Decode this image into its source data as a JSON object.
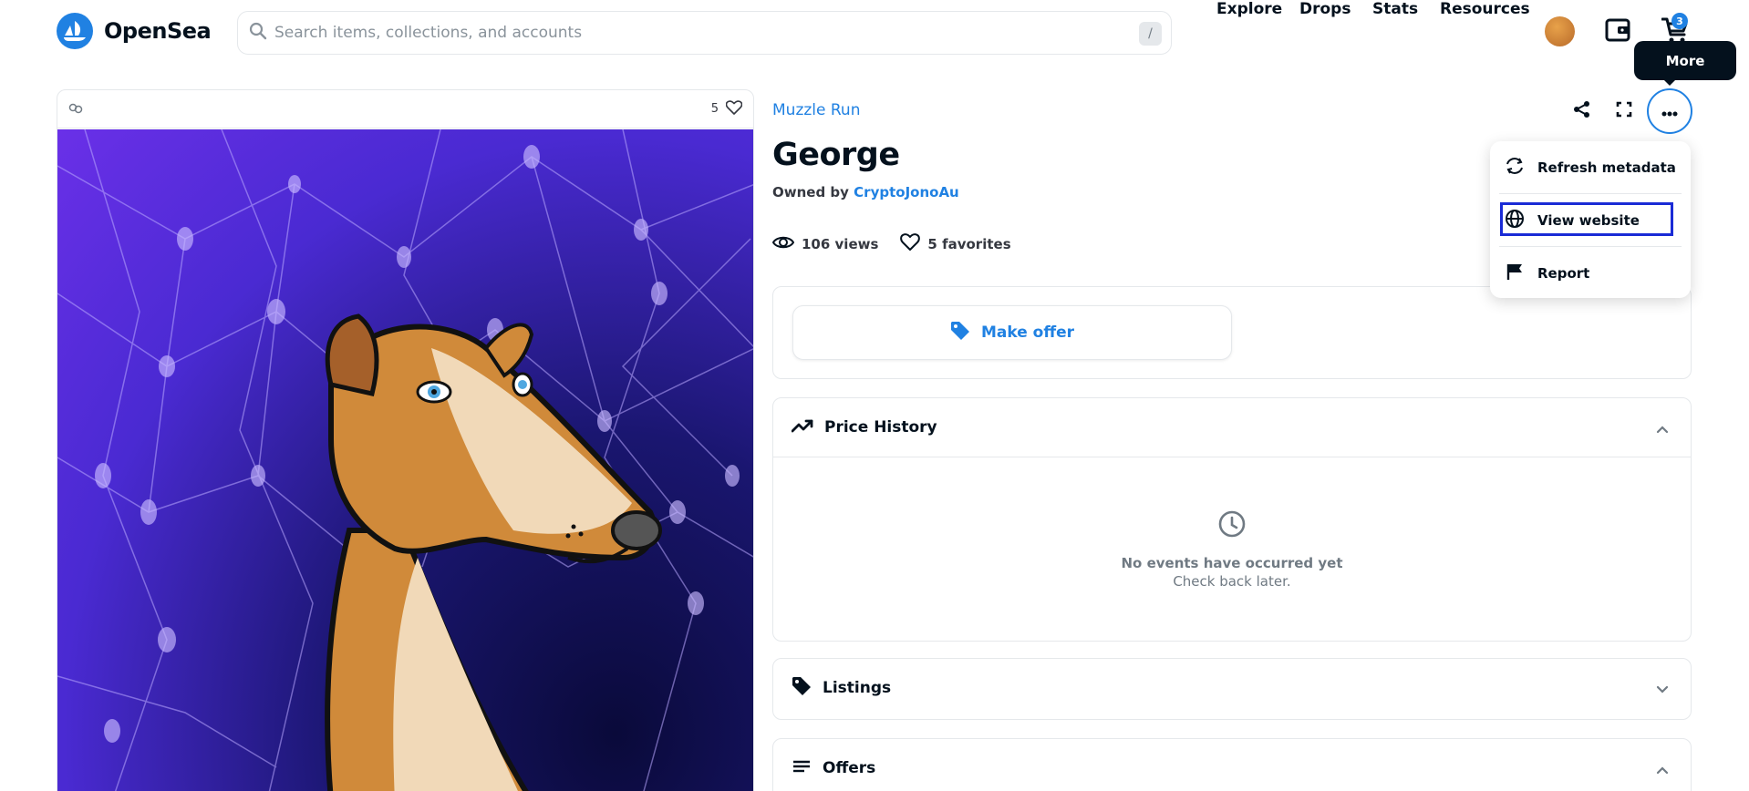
{
  "header": {
    "brand": "OpenSea",
    "search_placeholder": "Search items, collections, and accounts",
    "search_shortcut": "/",
    "nav": [
      "Explore",
      "Drops",
      "Stats",
      "Resources"
    ],
    "cart_count": "3"
  },
  "tooltip": "More",
  "item_card": {
    "favorites_count": "5"
  },
  "item": {
    "collection": "Muzzle Run",
    "title": "George",
    "owned_by_label": "Owned by",
    "owner": "CryptoJonoAu",
    "views": "106 views",
    "favorites": "5 favorites"
  },
  "offer": {
    "make_offer_label": "Make offer"
  },
  "sections": {
    "price_history": "Price History",
    "empty_title": "No events have occurred yet",
    "empty_sub": "Check back later.",
    "listings": "Listings",
    "offers": "Offers"
  },
  "more_menu": {
    "items": [
      "Refresh metadata",
      "View website",
      "Report"
    ]
  },
  "colors": {
    "accent": "#2081e2",
    "text": "#04111d",
    "border": "#e5e8eb"
  }
}
